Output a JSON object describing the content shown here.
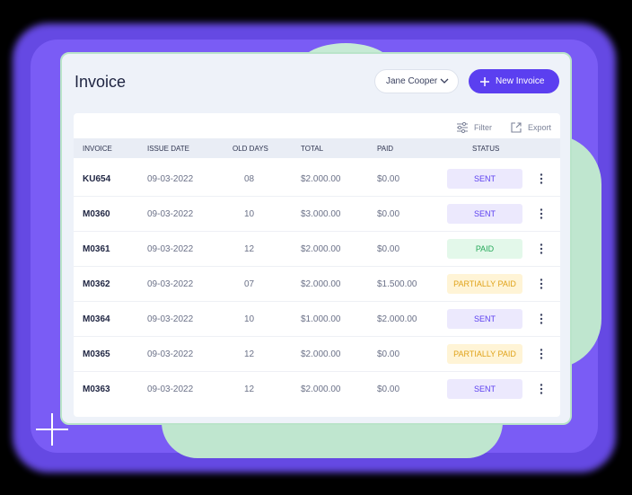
{
  "header": {
    "title": "Invoice",
    "user_select_value": "Jane Cooper",
    "new_button_label": "New Invoice"
  },
  "toolbar": {
    "filter_label": "Filter",
    "export_label": "Export"
  },
  "table": {
    "columns": [
      "INVOICE",
      "ISSUE DATE",
      "OLD DAYS",
      "TOTAL",
      "PAID",
      "STATUS"
    ],
    "rows": [
      {
        "invoice": "KU654",
        "issue_date": "09-03-2022",
        "old_days": "08",
        "total": "$2.000.00",
        "paid": "$0.00",
        "status": "SENT"
      },
      {
        "invoice": "M0360",
        "issue_date": "09-03-2022",
        "old_days": "10",
        "total": "$3.000.00",
        "paid": "$0.00",
        "status": "SENT"
      },
      {
        "invoice": "M0361",
        "issue_date": "09-03-2022",
        "old_days": "12",
        "total": "$2.000.00",
        "paid": "$0.00",
        "status": "PAID"
      },
      {
        "invoice": "M0362",
        "issue_date": "09-03-2022",
        "old_days": "07",
        "total": "$2.000.00",
        "paid": "$1.500.00",
        "status": "PARTIALLY PAID"
      },
      {
        "invoice": "M0364",
        "issue_date": "09-03-2022",
        "old_days": "10",
        "total": "$1.000.00",
        "paid": "$2.000.00",
        "status": "SENT"
      },
      {
        "invoice": "M0365",
        "issue_date": "09-03-2022",
        "old_days": "12",
        "total": "$2.000.00",
        "paid": "$0.00",
        "status": "PARTIALLY PAID"
      },
      {
        "invoice": "M0363",
        "issue_date": "09-03-2022",
        "old_days": "12",
        "total": "$2.000.00",
        "paid": "$0.00",
        "status": "SENT"
      }
    ]
  },
  "colors": {
    "accent": "#5b3ff0",
    "sent_bg": "#ece9fd",
    "sent_fg": "#5b3ff0",
    "paid_bg": "#e3f8ea",
    "paid_fg": "#27a95a",
    "partial_bg": "#fff4d6",
    "partial_fg": "#e0a31a"
  },
  "icons": {
    "user_select_chevron": "chevron-down-icon",
    "new_button": "plus-icon",
    "filter": "sliders-icon",
    "export": "export-icon",
    "row_menu": "more-vertical-icon"
  }
}
